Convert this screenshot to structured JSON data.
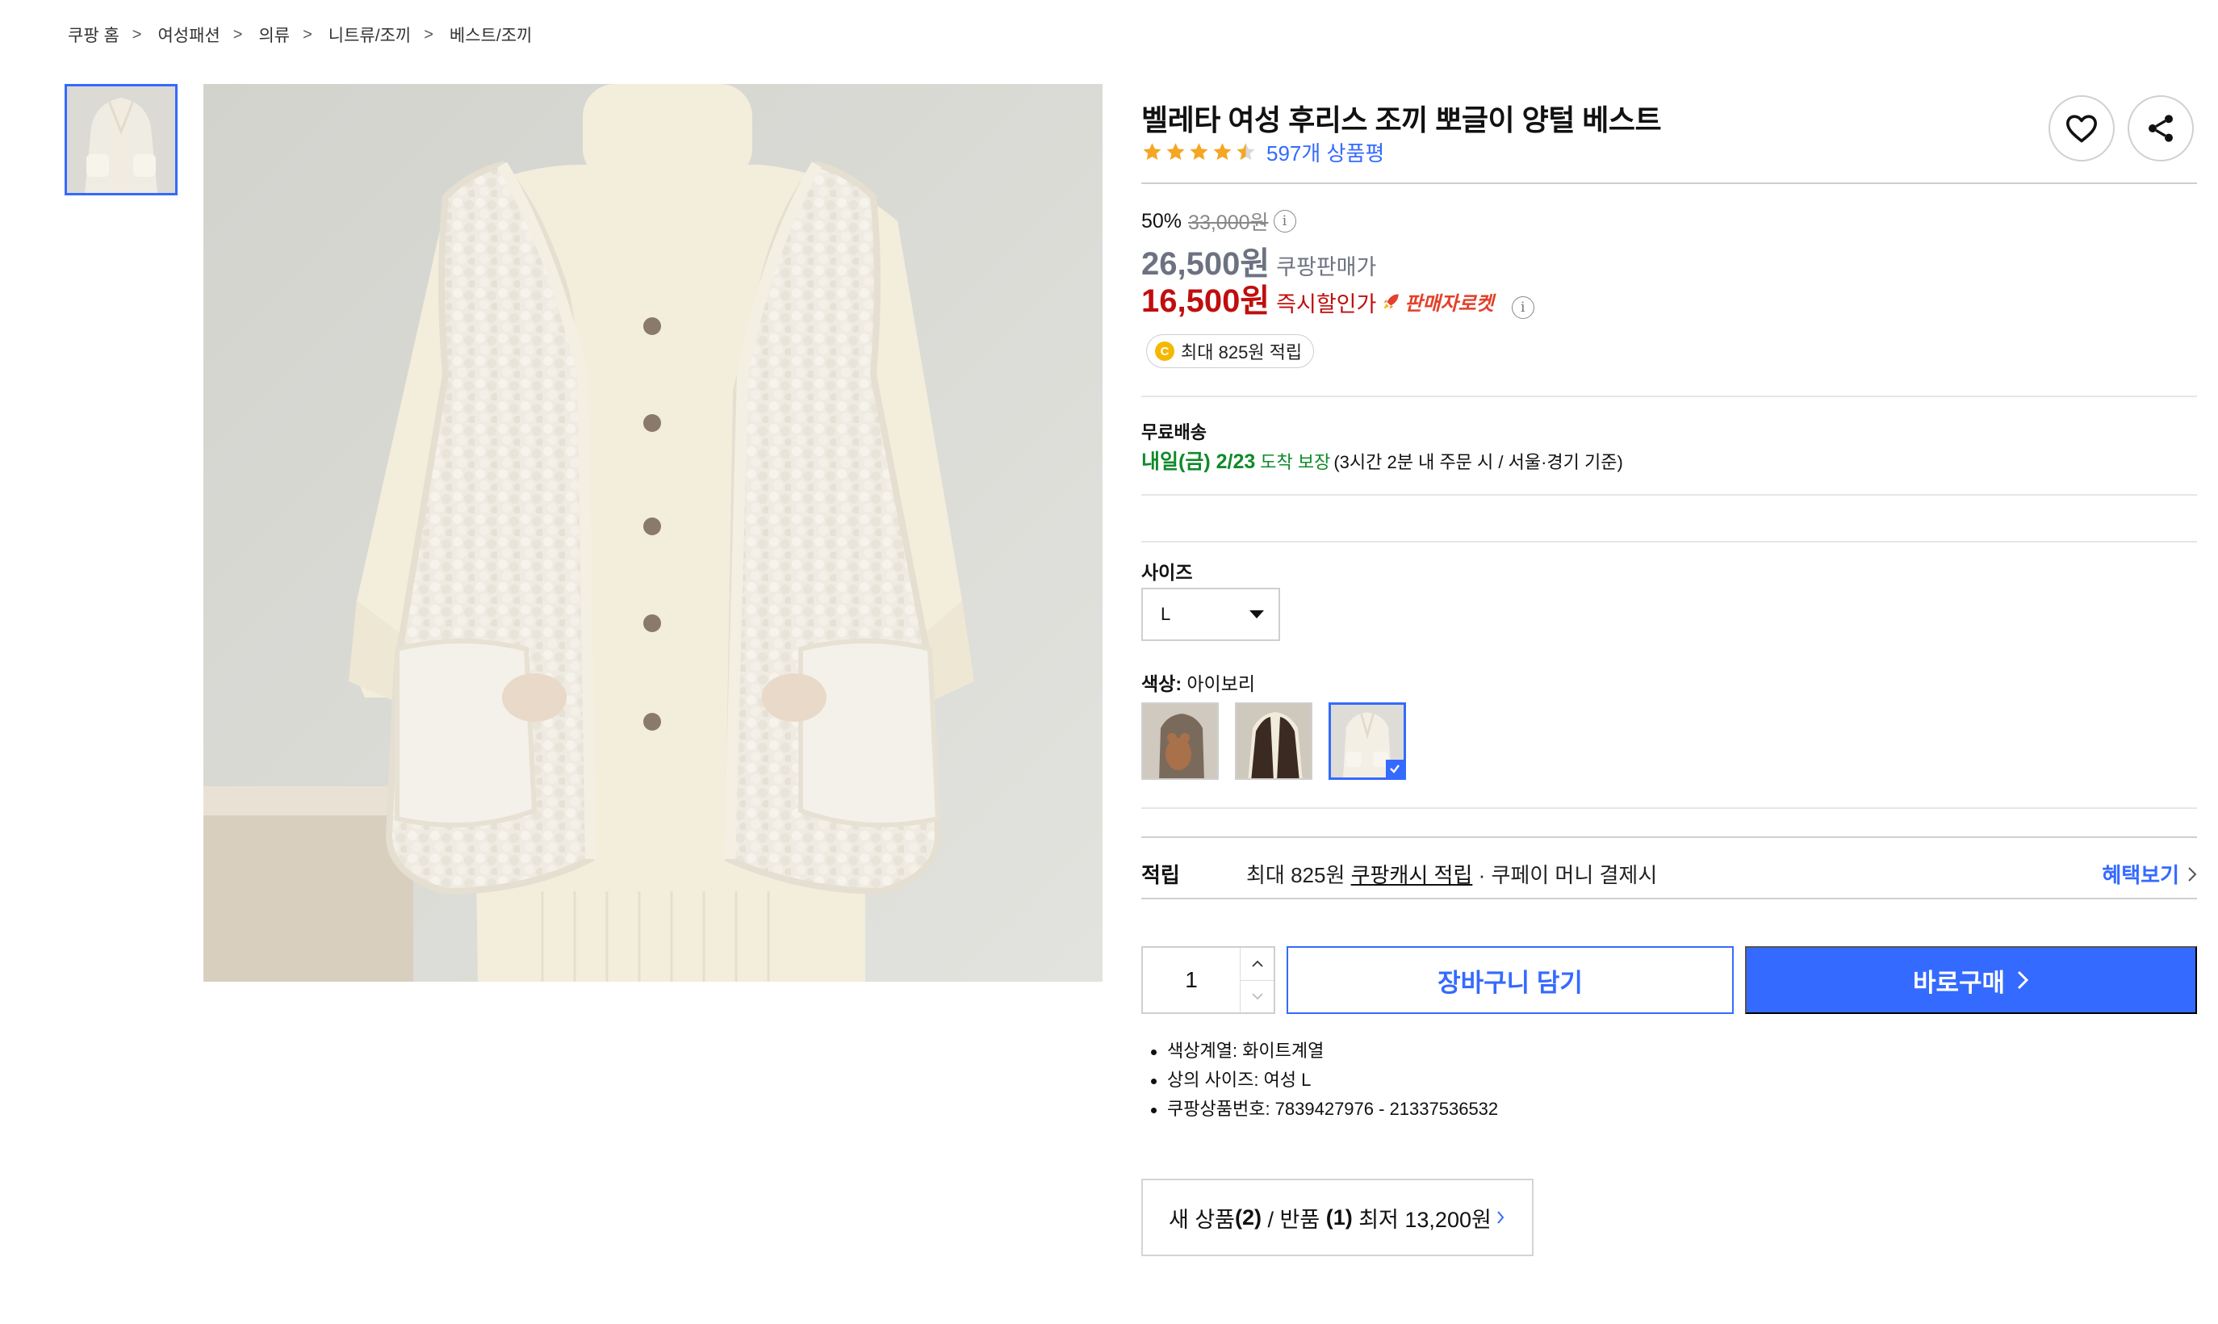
{
  "breadcrumb": [
    "쿠팡 홈",
    "여성패션",
    "의류",
    "니트류/조끼",
    "베스트/조끼"
  ],
  "breadcrumb_separator": ">",
  "product": {
    "title": "벨레타 여성 후리스 조끼 뽀글이 양털 베스트",
    "rating": 4.5,
    "review_count_label": "597개 상품평"
  },
  "pricing": {
    "discount_rate": "50%",
    "original_price": "33,000원",
    "sale_price": "26,500원",
    "sale_price_label": "쿠팡판매가",
    "instant_price": "16,500원",
    "instant_price_label": "즉시할인가",
    "rocket_label": "판매자로켓",
    "info_glyph": "i"
  },
  "cash_badge": {
    "coin_letter": "C",
    "text": "최대 825원 적립"
  },
  "shipping": {
    "title": "무료배송",
    "date": "내일(금) 2/23",
    "guarantee": "도착 보장",
    "note": "(3시간 2분 내 주문 시 / 서울·경기 기준)"
  },
  "options": {
    "size_label": "사이즈",
    "size_value": "L",
    "color_label": "색상:",
    "color_value": "아이보리",
    "swatch_count": 3,
    "selected_swatch": 3
  },
  "points": {
    "title": "적립",
    "prefix": "최대 825원 ",
    "link": "쿠팡캐시 적립",
    "suffix": " · 쿠페이 머니 결제시",
    "benefit_link": "혜택보기"
  },
  "purchase": {
    "quantity": "1",
    "cart_label": "장바구니 담기",
    "buy_label": "바로구매"
  },
  "attributes": [
    "색상계열: 화이트계열",
    "상의 사이즈: 여성 L",
    "쿠팡상품번호: 7839427976 - 21337536532"
  ],
  "other_sellers": {
    "prefix": "새 상품 ",
    "new_count": "(2)",
    "middle": " / 반품 ",
    "return_count": "(1)",
    "price_text": " 최저 13,200원"
  },
  "colors": {
    "accent": "#346aff",
    "sale_red": "#c00e0e",
    "shipping_green": "#0f8a2a",
    "star": "#f5a623"
  },
  "icons": [
    "heart-icon",
    "share-icon",
    "star-icon",
    "info-icon",
    "rocket-icon",
    "coin-icon",
    "caret-down-icon",
    "check-icon",
    "chevron-up-icon",
    "chevron-down-icon",
    "chevron-right-icon"
  ]
}
